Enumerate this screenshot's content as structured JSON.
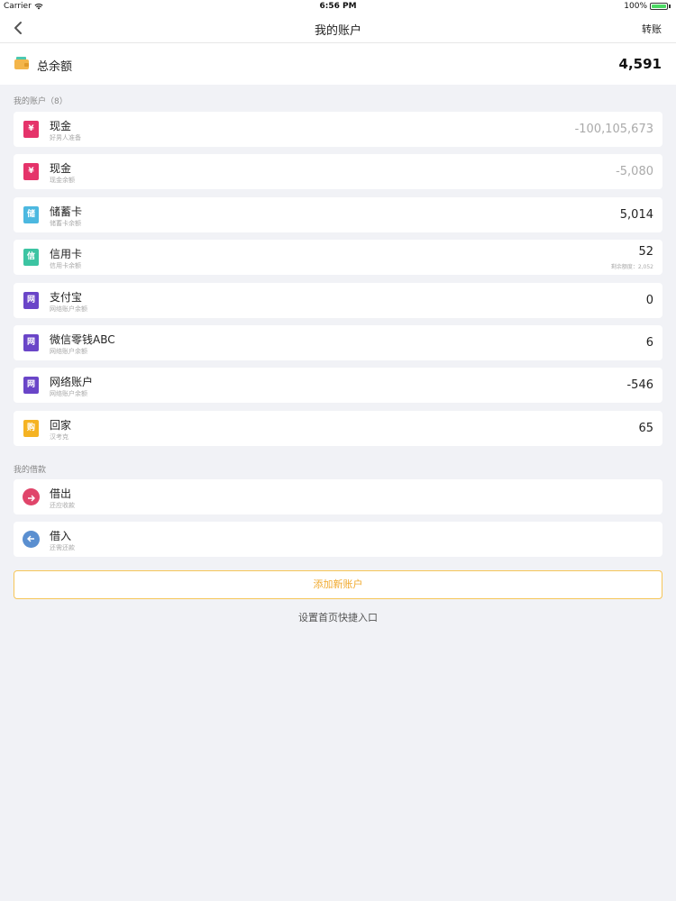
{
  "status_bar": {
    "carrier": "Carrier",
    "time": "6:56 PM",
    "battery": "100%",
    "battery_level": 1.0
  },
  "nav": {
    "title": "我的账户",
    "transfer_label": "转账"
  },
  "total": {
    "label": "总余额",
    "amount": "4,591"
  },
  "accounts_section": {
    "title": "我的账户（8）",
    "items": [
      {
        "name": "现金",
        "sub": "好男人准备",
        "value": "-100,105,673",
        "icon_text": "¥",
        "icon_color": "#e5336a",
        "muted": true
      },
      {
        "name": "现金",
        "sub": "现金余额",
        "value": "-5,080",
        "icon_text": "¥",
        "icon_color": "#e5336a",
        "muted": true
      },
      {
        "name": "储蓄卡",
        "sub": "储蓄卡余额",
        "value": "5,014",
        "icon_text": "储",
        "icon_color": "#4cb8e0",
        "muted": false
      },
      {
        "name": "信用卡",
        "sub": "信用卡余额",
        "value": "52",
        "icon_text": "信",
        "icon_color": "#3cc4a2",
        "muted": false,
        "remaining": "剩余额度：2,052"
      },
      {
        "name": "支付宝",
        "sub": "网络账户余额",
        "value": "0",
        "icon_text": "网",
        "icon_color": "#6a45c8",
        "muted": false
      },
      {
        "name": "微信零钱ABC",
        "sub": "网络账户余额",
        "value": "6",
        "icon_text": "网",
        "icon_color": "#6a45c8",
        "muted": false
      },
      {
        "name": "网络账户",
        "sub": "网络账户余额",
        "value": "-546",
        "icon_text": "网",
        "icon_color": "#6a45c8",
        "muted": false
      },
      {
        "name": "回家",
        "sub": "汉考克",
        "value": "65",
        "icon_text": "购",
        "icon_color": "#f5b323",
        "muted": false
      }
    ]
  },
  "loans_section": {
    "title": "我的借款",
    "items": [
      {
        "name": "借出",
        "sub": "还应收款",
        "icon_color": "#e0456a"
      },
      {
        "name": "借入",
        "sub": "还需还款",
        "icon_color": "#5a8fd0"
      }
    ]
  },
  "add_account_label": "添加新账户",
  "shortcut_label": "设置首页快捷入口",
  "colors": {
    "accent": "#f0a92e",
    "background": "#f1f2f6"
  }
}
